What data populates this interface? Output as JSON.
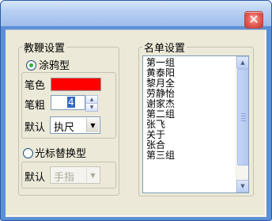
{
  "window": {
    "close_glyph": "✕"
  },
  "pointer_group": {
    "title": "教鞭设置",
    "mode_scribble": {
      "label": "涂鸦型",
      "selected": true
    },
    "color_label": "笔色",
    "color_value": "#ff0000",
    "thickness_label": "笔粗",
    "thickness_value": "4",
    "default_label": "默认",
    "default_value": "执尺",
    "mode_cursor": {
      "label": "光标替换型",
      "selected": false
    },
    "cursor_default_label": "默认",
    "cursor_default_value": "手指"
  },
  "roster_group": {
    "title": "名单设置",
    "items": [
      "第一组",
      "黄泰阳",
      "黎月全",
      "劳静怡",
      "谢家杰",
      "第二组",
      "张飞",
      "关于",
      "张合",
      "第三组"
    ]
  },
  "icons": {
    "close": "close-icon",
    "radio_selected": "radio-selected-icon",
    "dropdown": "chevron-down-icon"
  }
}
